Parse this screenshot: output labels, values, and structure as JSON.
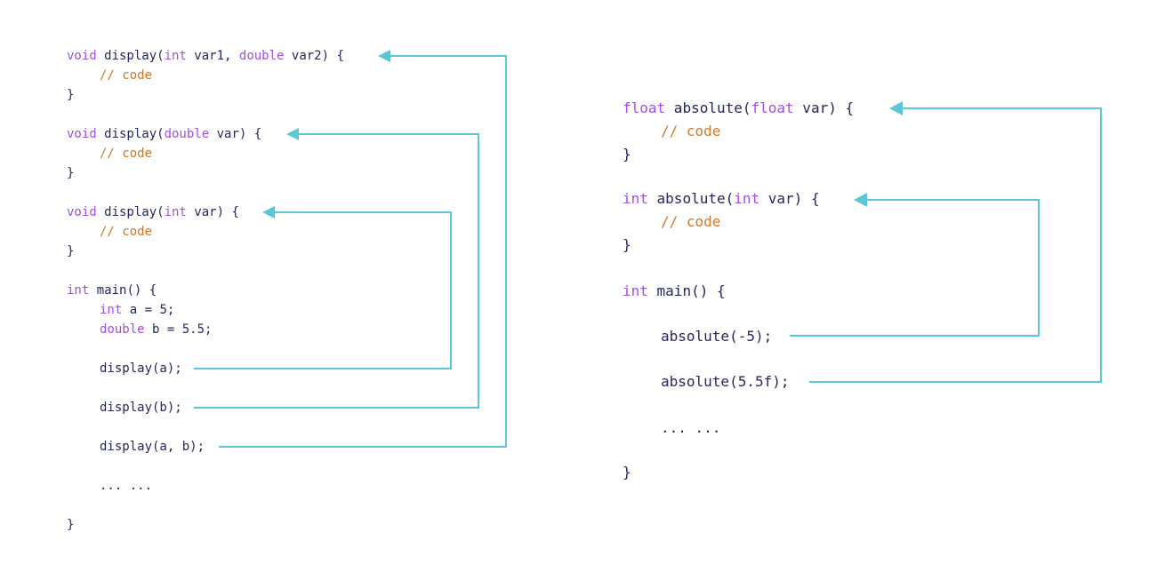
{
  "colors": {
    "keyword": "#a04fe6",
    "comment": "#d0782a",
    "text": "#25265e",
    "arrow": "#5bc6d6"
  },
  "left_code": {
    "f1_kw": "void",
    "f1_a": " display(",
    "f1_kw2": "int",
    "f1_b": " var1, ",
    "f1_kw3": "double",
    "f1_c": " var2) {",
    "f1_cm": "// code",
    "f1_close": "}",
    "f2_kw": "void",
    "f2_a": " display(",
    "f2_kw2": "double",
    "f2_b": " var) {",
    "f2_cm": "// code",
    "f2_close": "}",
    "f3_kw": "void",
    "f3_a": " display(",
    "f3_kw2": "int",
    "f3_b": " var) {",
    "f3_cm": "// code",
    "f3_close": "}",
    "main_kw": "int",
    "main_a": " main() {",
    "l_a_kw": "int",
    "l_a_rest": " a = 5;",
    "l_b_kw": "double",
    "l_b_rest": " b = 5.5;",
    "call1": "display(a);",
    "call2": "display(b);",
    "call3": "display(a, b);",
    "dots": "... ...",
    "main_close": "}"
  },
  "right_code": {
    "f1_kw": "float",
    "f1_a": " absolute(",
    "f1_kw2": "float",
    "f1_b": " var) {",
    "f1_cm": "// code",
    "f1_close": "}",
    "f2_kw": "int",
    "f2_a": " absolute(",
    "f2_kw2": "int",
    "f2_b": " var) {",
    "f2_cm": "// code",
    "f2_close": "}",
    "main_kw": "int",
    "main_a": " main() {",
    "call1": "absolute(-5);",
    "call2": "absolute(5.5f);",
    "dots": "... ...",
    "main_close": "}"
  }
}
